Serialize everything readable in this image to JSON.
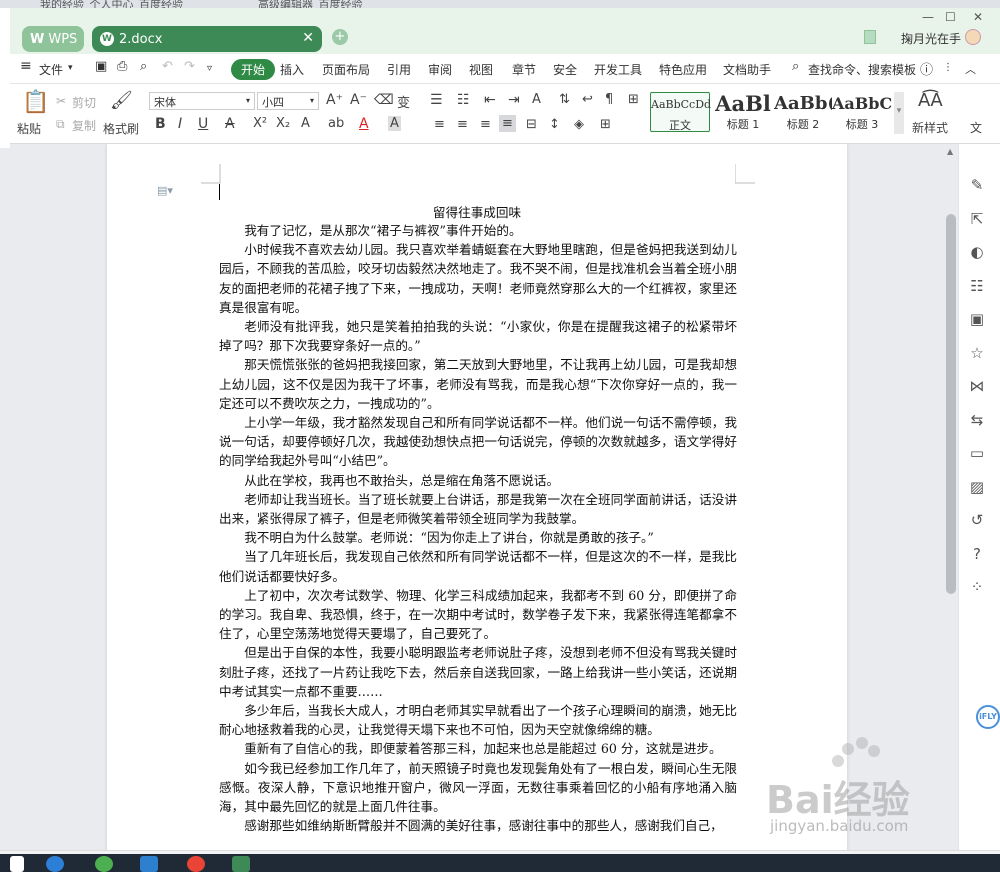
{
  "browser_tabs": [
    "我的经验_个人中心_百度经验",
    "高级编辑器_百度经验"
  ],
  "tabs": {
    "wps_label": "WPS",
    "doc_label": "2.docx"
  },
  "titlebar": {
    "user": "掬月光在手"
  },
  "menu": {
    "file": "文件",
    "items": [
      "开始",
      "插入",
      "页面布局",
      "引用",
      "审阅",
      "视图",
      "章节",
      "安全",
      "开发工具",
      "特色应用",
      "文档助手"
    ],
    "active": "开始",
    "search": "查找命令、搜索模板"
  },
  "ribbon": {
    "paste": "粘贴",
    "cut": "剪切",
    "copy": "复制",
    "format_painter": "格式刷",
    "font_name": "宋体",
    "font_size": "小四",
    "styles": [
      {
        "sample": "AaBbCcDd",
        "name": "正文"
      },
      {
        "sample": "AaBl",
        "name": "标题 1"
      },
      {
        "sample": "AaBb(",
        "name": "标题 2"
      },
      {
        "sample": "AaBbC",
        "name": "标题 3"
      }
    ],
    "new_style": "新样式",
    "more": "文"
  },
  "document": {
    "title": "留得往事成回味",
    "paragraphs": [
      "我有了记忆，是从那次“裙子与裤衩”事件开始的。",
      "小时候我不喜欢去幼儿园。我只喜欢举着蜻蜓套在大野地里瞎跑，但是爸妈把我送到幼儿园后，不顾我的苦瓜脸，咬牙切齿毅然决然地走了。我不哭不闹，但是找准机会当着全班小朋友的面把老师的花裙子拽了下来，一拽成功，天啊！老师竟然穿那么大的一个红裤衩，家里还真是很富有呢。",
      "老师没有批评我，她只是笑着拍拍我的头说：“小家伙，你是在提醒我这裙子的松紧带坏掉了吗？那下次我要穿条好一点的。”",
      "那天慌慌张张的爸妈把我接回家，第二天放到大野地里，不让我再上幼儿园，可是我却想上幼儿园，这不仅是因为我干了坏事，老师没有骂我，而是我心想“下次你穿好一点的，我一定还可以不费吹灰之力，一拽成功的”。",
      "上小学一年级，我才豁然发现自己和所有同学说话都不一样。他们说一句话不需停顿，我说一句话，却要停顿好几次，我越使劲想快点把一句话说完，停顿的次数就越多，语文学得好的同学给我起外号叫“小结巴”。",
      "从此在学校，我再也不敢抬头，总是缩在角落不愿说话。",
      "老师却让我当班长。当了班长就要上台讲话，那是我第一次在全班同学面前讲话，话没讲出来，紧张得尿了裤子，但是老师微笑着带领全班同学为我鼓掌。",
      "我不明白为什么鼓掌。老师说：“因为你走上了讲台，你就是勇敢的孩子。”",
      "当了几年班长后，我发现自己依然和所有同学说话都不一样，但是这次的不一样，是我比他们说话都要快好多。",
      "上了初中，次次考试数学、物理、化学三科成绩加起来，我都考不到 60 分，即便拼了命的学习。我自卑、我恐惧，终于，在一次期中考试时，数学卷子发下来，我紧张得连笔都拿不住了，心里空荡荡地觉得天要塌了，自己要死了。",
      "但是出于自保的本性，我要小聪明跟监考老师说肚子疼，没想到老师不但没有骂我关键时刻肚子疼，还找了一片药让我吃下去，然后亲自送我回家，一路上给我讲一些小笑话，还说期中考试其实一点都不重要……",
      "多少年后，当我长大成人，才明白老师其实早就看出了一个孩子心理瞬间的崩溃，她无比耐心地拯救着我的心灵，让我觉得天塌下来也不可怕，因为天空就像绵绵的糖。",
      "重新有了自信心的我，即便蒙着答那三科，加起来也总是能超过 60 分，这就是进步。",
      "如今我已经参加工作几年了，前天照镜子时竟也发现鬓角处有了一根白发，瞬间心生无限感慨。夜深人静，下意识地推开窗户，微风一浮面，无数往事乘着回忆的小船有序地涌入脑海，其中最先回忆的就是上面几件往事。",
      "感谢那些如维纳斯断臂般并不圆满的美好往事，感谢往事中的那些人，感谢我们自己，"
    ]
  },
  "sidebar_icons": [
    "pen-icon",
    "pointer-icon",
    "shapes-icon",
    "adjust-icon",
    "image-gallery-icon",
    "star-icon",
    "share-icon",
    "translate-icon",
    "archive-icon",
    "picture-icon",
    "history-icon",
    "help-icon",
    "apps-icon"
  ],
  "watermark": {
    "brand": "Bai经验",
    "url": "jingyan.baidu.com"
  },
  "ifly": "iFLY",
  "colors": {
    "accent": "#3d8a57",
    "tab_bg": "#8fc39a",
    "active_menu": "#2f8a46"
  }
}
